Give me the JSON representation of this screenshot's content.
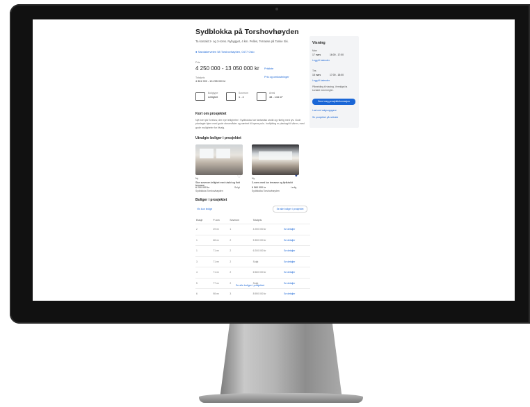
{
  "listing": {
    "title": "Sydblokka på Torshovhøyden",
    "subtitle": "Ta kontakt 2- og 3-roms. Nybygget, 4 km. Pelles, Terrasse på Tanke Ski.",
    "map_link": "Sandakerveien 58 Torshovhøyden, 0477 Oslo",
    "price_label": "Pris",
    "price": "4 250 000 - 13 050 000 kr",
    "price_link": "Prisliste",
    "fees_link": "Pris og omkostninger",
    "fees_label": "Totalpris",
    "fees_value": "4 361 900 - 13 255 000 kr"
  },
  "facts": [
    {
      "icon": "building-icon",
      "label": "Boligtype",
      "value": "Leilighet"
    },
    {
      "icon": "bed-icon",
      "label": "Soverom",
      "value": "1 - 4"
    },
    {
      "icon": "area-icon",
      "label": "Areal",
      "value": "48 - 144 m²"
    }
  ],
  "about": {
    "heading": "Kort om prosjektet",
    "text": "Nyt livet på Torshov, der nye leiligheter i Sydblokka har fantastisk utsikt og rikelig med lys. Godt planlagte hjem med gode uteområder og nærhet til byens puls. Innflytting er planlagt til våren, med gode muligheter for tilvalg."
  },
  "selected": {
    "heading": "Utvalgte boliger i prosjektet",
    "cards": [
      {
        "tag": "Ny",
        "title": "Stor soverom leilighet med utsikt og flott terrasse",
        "price": "6 200 000 kr",
        "note": "Sydblokka Torshovhøyden",
        "status": "Solgt",
        "favorite": false
      },
      {
        "tag": "Ny",
        "title": "3-roms med lun terrasse og fjellutsikt",
        "price": "6 560 000 kr",
        "note": "Sydblokka Torshovhøyden",
        "status": "Ledig",
        "favorite": true
      }
    ]
  },
  "units": {
    "heading": "Boliger i prosjektet",
    "filter_link": "Vis kun ledige",
    "filter_button": "Se alle boliger i prosjektet",
    "columns": [
      "Etasje",
      "P-rom",
      "Soverom",
      "Totalpris",
      ""
    ],
    "rows": [
      {
        "floor": "2",
        "area": "49 m²",
        "bedrooms": "1",
        "price": "4 250 000 kr",
        "action": "Se detaljer"
      },
      {
        "floor": "1",
        "area": "68 m²",
        "bedrooms": "2",
        "price": "5 350 000 kr",
        "action": "Se detaljer"
      },
      {
        "floor": "1",
        "area": "71 m²",
        "bedrooms": "2",
        "price": "6 200 000 kr",
        "action": "Se detaljer"
      },
      {
        "floor": "3",
        "area": "71 m²",
        "bedrooms": "2",
        "price": "Solgt",
        "action": "Se detaljer"
      },
      {
        "floor": "4",
        "area": "71 m²",
        "bedrooms": "2",
        "price": "6 560 000 kr",
        "action": "Se detaljer"
      },
      {
        "floor": "5",
        "area": "77 m²",
        "bedrooms": "2",
        "price": "Solgt",
        "action": "Se detaljer"
      },
      {
        "floor": "6",
        "area": "98 m²",
        "bedrooms": "3",
        "price": "8 950 000 kr",
        "action": "Se detaljer"
      }
    ],
    "see_all": "Se alle boliger i prosjektet"
  },
  "viewing": {
    "title": "Visning",
    "slot1_label": "Man",
    "slot1_date": "17 mars",
    "slot1_time": "16:00 - 17:00",
    "slot1_link": "Legg til kalender",
    "slot2_label": "Tirs",
    "slot2_date": "18 mars",
    "slot2_time": "17:00 - 18:00",
    "slot2_link": "Legg til kalender",
    "note": "Påmelding til visning. Vennligst ta kontakt med megler.",
    "cta": "Send meg prosjektinformasjon",
    "link1": "Last ned salgsoppgave",
    "link2": "Se prosjektet på nettside"
  }
}
